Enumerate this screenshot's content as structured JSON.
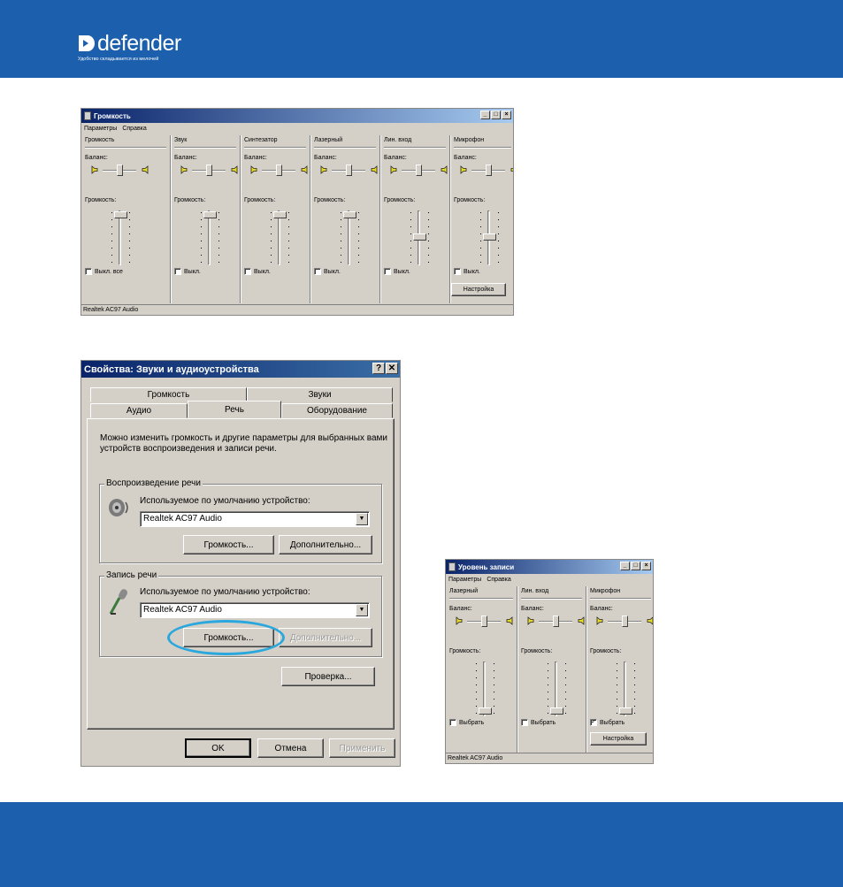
{
  "brand": {
    "logo_text": "defender",
    "tagline": "Удобство складывается из мелочей"
  },
  "volume_window": {
    "title": "Громкость",
    "menu": [
      "Параметры",
      "Справка"
    ],
    "columns": [
      {
        "name": "Громкость",
        "balance": "Баланс:",
        "volume": "Громкость:",
        "checkbox": "Выкл. все",
        "checked": false,
        "volume_level": 0.98
      },
      {
        "name": "Звук",
        "balance": "Баланс:",
        "volume": "Громкость:",
        "checkbox": "Выкл.",
        "checked": false,
        "volume_level": 0.98
      },
      {
        "name": "Синтезатор",
        "balance": "Баланс:",
        "volume": "Громкость:",
        "checkbox": "Выкл.",
        "checked": false,
        "volume_level": 0.98
      },
      {
        "name": "Лазерный",
        "balance": "Баланс:",
        "volume": "Громкость:",
        "checkbox": "Выкл.",
        "checked": false,
        "volume_level": 0.98
      },
      {
        "name": "Лин. вход",
        "balance": "Баланс:",
        "volume": "Громкость:",
        "checkbox": "Выкл.",
        "checked": false,
        "volume_level": 0.5
      },
      {
        "name": "Микрофон",
        "balance": "Баланс:",
        "volume": "Громкость:",
        "checkbox": "Выкл.",
        "checked": false,
        "volume_level": 0.5
      }
    ],
    "settings_button": "Настройка",
    "status": "Realtek AC97 Audio"
  },
  "properties_dialog": {
    "title": "Свойства: Звуки и аудиоустройства",
    "help_btn": "?",
    "close_btn": "✕",
    "tabs_back": [
      "Громкость",
      "Звуки"
    ],
    "tabs_front": [
      "Аудио",
      "Речь",
      "Оборудование"
    ],
    "active_tab": "Речь",
    "description": "Можно изменить громкость и другие параметры для выбранных вами устройств воспроизведения и записи речи.",
    "playback": {
      "title": "Воспроизведение речи",
      "label": "Используемое по умолчанию устройство:",
      "device": "Realtek AC97 Audio",
      "volume_btn": "Громкость...",
      "advanced_btn": "Дополнительно..."
    },
    "recording": {
      "title": "Запись речи",
      "label": "Используемое по умолчанию устройство:",
      "device": "Realtek AC97 Audio",
      "volume_btn": "Громкость...",
      "advanced_btn": "Дополнительно..."
    },
    "test_btn": "Проверка...",
    "ok_btn": "OK",
    "cancel_btn": "Отмена",
    "apply_btn": "Применить"
  },
  "recording_window": {
    "title": "Уровень записи",
    "menu": [
      "Параметры",
      "Справка"
    ],
    "columns": [
      {
        "name": "Лазерный",
        "balance": "Баланс:",
        "volume": "Громкость:",
        "checkbox": "Выбрать",
        "checked": false,
        "volume_level": 0.0
      },
      {
        "name": "Лин. вход",
        "balance": "Баланс:",
        "volume": "Громкость:",
        "checkbox": "Выбрать",
        "checked": false,
        "volume_level": 0.0
      },
      {
        "name": "Микрофон",
        "balance": "Баланс:",
        "volume": "Громкость:",
        "checkbox": "Выбрать",
        "checked": true,
        "volume_level": 0.0
      }
    ],
    "settings_button": "Настройка",
    "status": "Realtek AC97 Audio"
  },
  "colors": {
    "brand_blue": "#1c5fac",
    "win_face": "#d4d0c8",
    "highlight": "#2aa7dc"
  }
}
